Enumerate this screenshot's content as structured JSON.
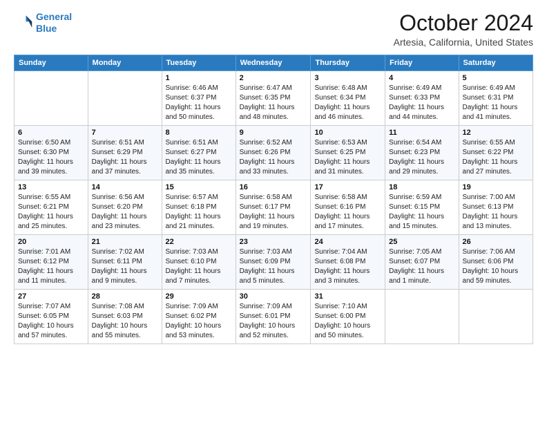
{
  "logo": {
    "line1": "General",
    "line2": "Blue"
  },
  "header": {
    "month": "October 2024",
    "location": "Artesia, California, United States"
  },
  "weekdays": [
    "Sunday",
    "Monday",
    "Tuesday",
    "Wednesday",
    "Thursday",
    "Friday",
    "Saturday"
  ],
  "weeks": [
    [
      {
        "day": "",
        "info": ""
      },
      {
        "day": "",
        "info": ""
      },
      {
        "day": "1",
        "info": "Sunrise: 6:46 AM\nSunset: 6:37 PM\nDaylight: 11 hours and 50 minutes."
      },
      {
        "day": "2",
        "info": "Sunrise: 6:47 AM\nSunset: 6:35 PM\nDaylight: 11 hours and 48 minutes."
      },
      {
        "day": "3",
        "info": "Sunrise: 6:48 AM\nSunset: 6:34 PM\nDaylight: 11 hours and 46 minutes."
      },
      {
        "day": "4",
        "info": "Sunrise: 6:49 AM\nSunset: 6:33 PM\nDaylight: 11 hours and 44 minutes."
      },
      {
        "day": "5",
        "info": "Sunrise: 6:49 AM\nSunset: 6:31 PM\nDaylight: 11 hours and 41 minutes."
      }
    ],
    [
      {
        "day": "6",
        "info": "Sunrise: 6:50 AM\nSunset: 6:30 PM\nDaylight: 11 hours and 39 minutes."
      },
      {
        "day": "7",
        "info": "Sunrise: 6:51 AM\nSunset: 6:29 PM\nDaylight: 11 hours and 37 minutes."
      },
      {
        "day": "8",
        "info": "Sunrise: 6:51 AM\nSunset: 6:27 PM\nDaylight: 11 hours and 35 minutes."
      },
      {
        "day": "9",
        "info": "Sunrise: 6:52 AM\nSunset: 6:26 PM\nDaylight: 11 hours and 33 minutes."
      },
      {
        "day": "10",
        "info": "Sunrise: 6:53 AM\nSunset: 6:25 PM\nDaylight: 11 hours and 31 minutes."
      },
      {
        "day": "11",
        "info": "Sunrise: 6:54 AM\nSunset: 6:23 PM\nDaylight: 11 hours and 29 minutes."
      },
      {
        "day": "12",
        "info": "Sunrise: 6:55 AM\nSunset: 6:22 PM\nDaylight: 11 hours and 27 minutes."
      }
    ],
    [
      {
        "day": "13",
        "info": "Sunrise: 6:55 AM\nSunset: 6:21 PM\nDaylight: 11 hours and 25 minutes."
      },
      {
        "day": "14",
        "info": "Sunrise: 6:56 AM\nSunset: 6:20 PM\nDaylight: 11 hours and 23 minutes."
      },
      {
        "day": "15",
        "info": "Sunrise: 6:57 AM\nSunset: 6:18 PM\nDaylight: 11 hours and 21 minutes."
      },
      {
        "day": "16",
        "info": "Sunrise: 6:58 AM\nSunset: 6:17 PM\nDaylight: 11 hours and 19 minutes."
      },
      {
        "day": "17",
        "info": "Sunrise: 6:58 AM\nSunset: 6:16 PM\nDaylight: 11 hours and 17 minutes."
      },
      {
        "day": "18",
        "info": "Sunrise: 6:59 AM\nSunset: 6:15 PM\nDaylight: 11 hours and 15 minutes."
      },
      {
        "day": "19",
        "info": "Sunrise: 7:00 AM\nSunset: 6:13 PM\nDaylight: 11 hours and 13 minutes."
      }
    ],
    [
      {
        "day": "20",
        "info": "Sunrise: 7:01 AM\nSunset: 6:12 PM\nDaylight: 11 hours and 11 minutes."
      },
      {
        "day": "21",
        "info": "Sunrise: 7:02 AM\nSunset: 6:11 PM\nDaylight: 11 hours and 9 minutes."
      },
      {
        "day": "22",
        "info": "Sunrise: 7:03 AM\nSunset: 6:10 PM\nDaylight: 11 hours and 7 minutes."
      },
      {
        "day": "23",
        "info": "Sunrise: 7:03 AM\nSunset: 6:09 PM\nDaylight: 11 hours and 5 minutes."
      },
      {
        "day": "24",
        "info": "Sunrise: 7:04 AM\nSunset: 6:08 PM\nDaylight: 11 hours and 3 minutes."
      },
      {
        "day": "25",
        "info": "Sunrise: 7:05 AM\nSunset: 6:07 PM\nDaylight: 11 hours and 1 minute."
      },
      {
        "day": "26",
        "info": "Sunrise: 7:06 AM\nSunset: 6:06 PM\nDaylight: 10 hours and 59 minutes."
      }
    ],
    [
      {
        "day": "27",
        "info": "Sunrise: 7:07 AM\nSunset: 6:05 PM\nDaylight: 10 hours and 57 minutes."
      },
      {
        "day": "28",
        "info": "Sunrise: 7:08 AM\nSunset: 6:03 PM\nDaylight: 10 hours and 55 minutes."
      },
      {
        "day": "29",
        "info": "Sunrise: 7:09 AM\nSunset: 6:02 PM\nDaylight: 10 hours and 53 minutes."
      },
      {
        "day": "30",
        "info": "Sunrise: 7:09 AM\nSunset: 6:01 PM\nDaylight: 10 hours and 52 minutes."
      },
      {
        "day": "31",
        "info": "Sunrise: 7:10 AM\nSunset: 6:00 PM\nDaylight: 10 hours and 50 minutes."
      },
      {
        "day": "",
        "info": ""
      },
      {
        "day": "",
        "info": ""
      }
    ]
  ]
}
